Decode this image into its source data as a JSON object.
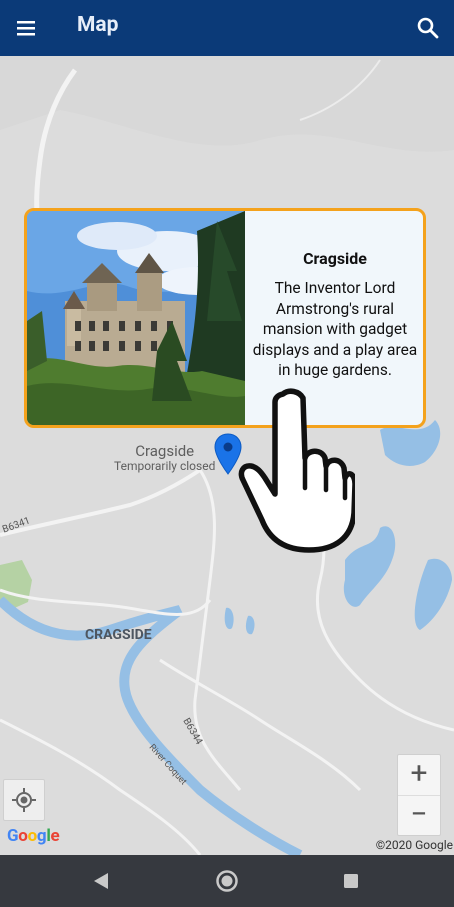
{
  "appbar": {
    "title": "Map",
    "menu_icon": "menu-icon",
    "search_icon": "search-icon",
    "bg": "#0b3a78"
  },
  "card": {
    "title": "Cragside",
    "description": "The Inventor Lord Armstrong's rural mansion with gadget displays and a play area in huge gardens.",
    "border_color": "#f4a21c",
    "image": "photo of Cragside mansion among trees"
  },
  "marker": {
    "name": "Cragside",
    "status": "Temporarily closed",
    "color": "#1a73e8"
  },
  "map_labels": {
    "area": "CRAGSIDE",
    "road_b6341": "B6341",
    "road_b6344": "B6344",
    "river": "River Coquet"
  },
  "controls": {
    "zoom_in": "+",
    "zoom_out": "−",
    "my_location_icon": "my-location-icon"
  },
  "attribution": {
    "google": "Google",
    "copyright": "©2020 Google"
  },
  "navbar": {
    "back_icon": "back-icon",
    "home_icon": "home-icon",
    "recents_icon": "recents-icon"
  }
}
